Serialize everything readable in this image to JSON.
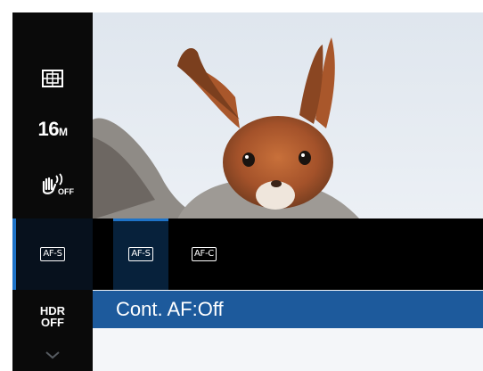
{
  "sidebar": {
    "items": [
      {
        "name": "metering",
        "icon": "metering-icon"
      },
      {
        "name": "image-size",
        "label": "16",
        "unit": "M"
      },
      {
        "name": "stabilization",
        "icon": "hand-shake-off-icon",
        "status": "OFF"
      },
      {
        "name": "af-mode",
        "label": "AF-S",
        "selected": true
      },
      {
        "name": "hdr",
        "label_top": "HDR",
        "label_bottom": "OFF"
      },
      {
        "name": "more",
        "icon": "chevron-down-icon"
      }
    ]
  },
  "options": [
    {
      "label": "AF-S",
      "selected": true
    },
    {
      "label": "AF-C",
      "selected": false
    }
  ],
  "description": "Cont. AF:Off",
  "colors": {
    "accent": "#1e73c8",
    "description_bar": "#1d5a9c",
    "background": "#000000"
  }
}
